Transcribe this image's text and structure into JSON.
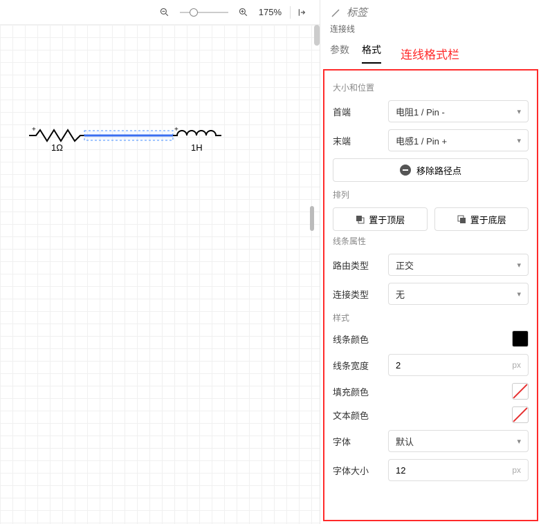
{
  "toolbar": {
    "zoom_pct": "175%"
  },
  "canvas": {
    "resistor_label": "1Ω",
    "inductor_label": "1H",
    "plus": "+"
  },
  "panel": {
    "label_placeholder": "标签",
    "subtype": "连接线",
    "tabs": {
      "params": "参数",
      "format": "格式"
    },
    "callout": "连线格式栏",
    "size_pos": {
      "title": "大小和位置",
      "start_label": "首端",
      "start_value": "电阻1 / Pin -",
      "end_label": "末端",
      "end_value": "电感1 / Pin +",
      "remove_waypoints": "移除路径点"
    },
    "arrange": {
      "title": "排列",
      "bring_front": "置于顶层",
      "send_back": "置于底层"
    },
    "line_props": {
      "title": "线条属性",
      "routing_label": "路由类型",
      "routing_value": "正交",
      "conn_label": "连接类型",
      "conn_value": "无"
    },
    "style": {
      "title": "样式",
      "line_color": "线条颜色",
      "line_width_label": "线条宽度",
      "line_width_value": "2",
      "fill_color": "填充颜色",
      "text_color": "文本颜色",
      "font_label": "字体",
      "font_value": "默认",
      "font_size_label": "字体大小",
      "font_size_value": "12",
      "unit_px": "px"
    }
  }
}
